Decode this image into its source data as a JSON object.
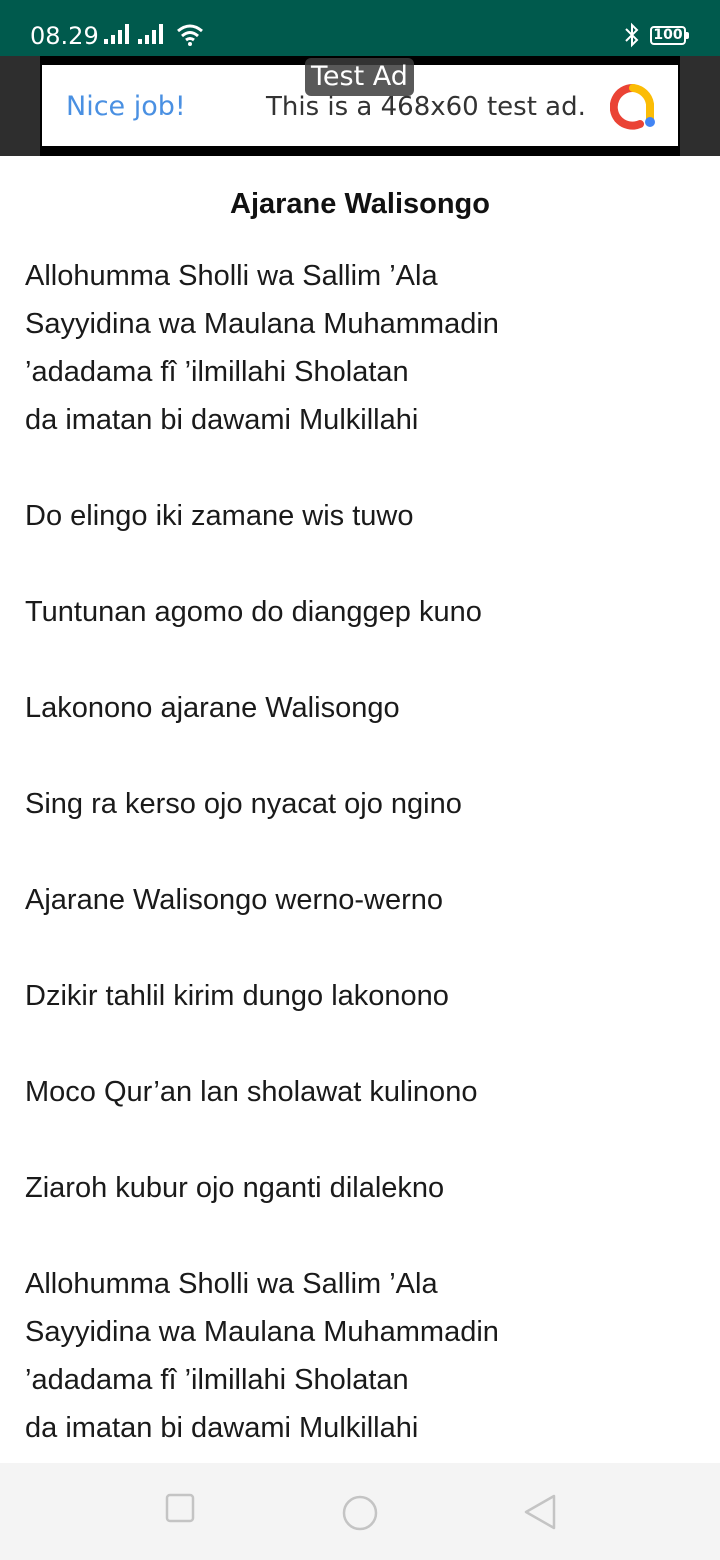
{
  "status_bar": {
    "time": "08.29",
    "battery": "100",
    "icons": [
      "signal-icon",
      "signal-icon",
      "wifi-icon",
      "bluetooth-icon",
      "battery-icon"
    ]
  },
  "ad": {
    "label": "Test Ad",
    "headline": "Nice job!",
    "text": "This is a 468x60 test ad.",
    "logo_icon": "admob-logo-icon"
  },
  "page": {
    "title": "Ajarane Walisongo",
    "lines": [
      "Allohumma Sholli wa Sallim ’Ala",
      "Sayyidina wa Maulana Muhammadin",
      "’adadama fî ’ilmillahi Sholatan",
      "da imatan bi dawami Mulkillahi",
      "",
      "Do elingo iki zamane wis tuwo",
      "",
      "Tuntunan agomo do dianggep kuno",
      "",
      "Lakonono ajarane Walisongo",
      "",
      "Sing ra kerso ojo nyacat ojo ngino",
      "",
      "Ajarane Walisongo werno-werno",
      "",
      "Dzikir tahlil kirim dungo lakonono",
      "",
      "Moco Qur’an lan sholawat kulinono",
      "",
      "Ziaroh kubur ojo nganti dilalekno",
      "",
      "Allohumma Sholli wa Sallim ’Ala",
      "Sayyidina wa Maulana Muhammadin",
      "’adadama fî ’ilmillahi Sholatan",
      "da imatan bi dawami Mulkillahi"
    ]
  },
  "nav_bar": {
    "buttons": [
      "recents-square-icon",
      "home-circle-icon",
      "back-triangle-icon"
    ]
  },
  "colors": {
    "status_bar": "#005a4d",
    "ad_headline": "#4a90e2",
    "nav_bar": "#f4f4f4"
  }
}
